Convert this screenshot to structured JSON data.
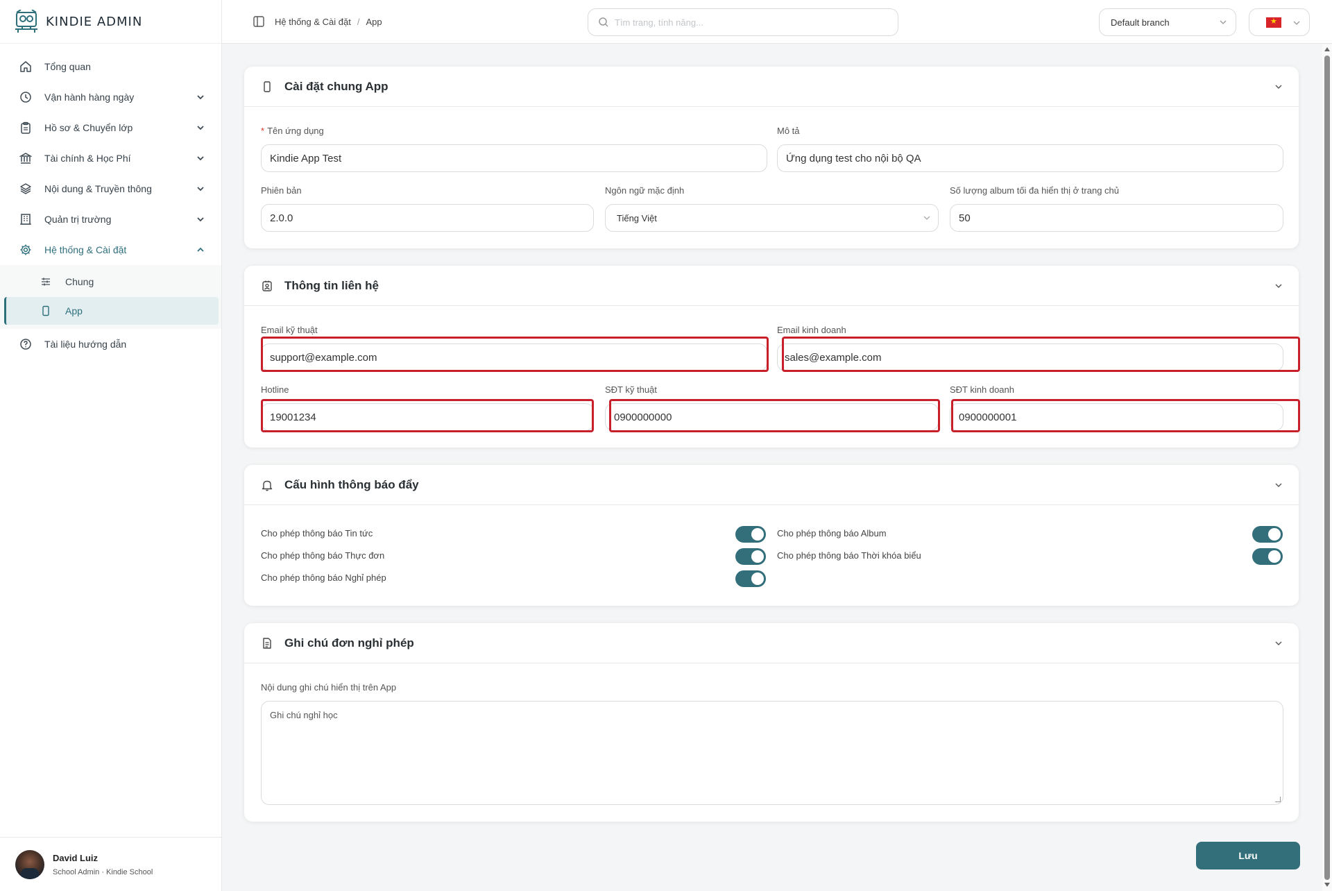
{
  "app": {
    "name": "KINDIE ADMIN"
  },
  "sidebar": {
    "items": [
      {
        "label": "Tổng quan",
        "icon": "home-icon",
        "expandable": false
      },
      {
        "label": "Vận hành hàng ngày",
        "icon": "clock-icon",
        "expandable": true
      },
      {
        "label": "Hồ sơ & Chuyển lớp",
        "icon": "clipboard-icon",
        "expandable": true
      },
      {
        "label": "Tài chính & Học Phí",
        "icon": "bank-icon",
        "expandable": true
      },
      {
        "label": "Nội dung & Truyền thông",
        "icon": "layers-icon",
        "expandable": true
      },
      {
        "label": "Quản trị trường",
        "icon": "building-icon",
        "expandable": true
      },
      {
        "label": "Hệ thống & Cài đặt",
        "icon": "gear-icon",
        "expandable": true,
        "expanded": true
      },
      {
        "label": "Tài liệu hướng dẫn",
        "icon": "help-icon",
        "expandable": false
      }
    ],
    "subitems": [
      {
        "label": "Chung",
        "icon": "sliders-icon"
      },
      {
        "label": "App",
        "icon": "phone-icon",
        "active": true
      }
    ]
  },
  "user": {
    "name": "David Luiz",
    "role": "School Admin · Kindie School"
  },
  "topbar": {
    "breadcrumb": [
      "Hệ thống & Cài đặt",
      "App"
    ],
    "search_placeholder": "Tìm trang, tính năng...",
    "branch": "Default branch",
    "language_flag": "vietnam-flag"
  },
  "sections": {
    "general": {
      "title": "Cài đặt chung App",
      "app_name_label": "Tên ứng dụng",
      "app_name_value": "Kindie App Test",
      "description_label": "Mô tả",
      "description_value": "Ứng dụng test cho nội bộ QA",
      "version_label": "Phiên bản",
      "version_value": "2.0.0",
      "language_label": "Ngôn ngữ mặc định",
      "language_value": "Tiếng Việt",
      "album_label": "Số lượng album tối đa hiển thị ở trang chủ",
      "album_value": "50"
    },
    "contact": {
      "title": "Thông tin liên hệ",
      "tech_email_label": "Email kỹ thuật",
      "tech_email_value": "support@example.com",
      "sales_email_label": "Email kinh doanh",
      "sales_email_value": "sales@example.com",
      "hotline_label": "Hotline",
      "hotline_value": "19001234",
      "tech_phone_label": "SĐT kỹ thuật",
      "tech_phone_value": "0900000000",
      "sales_phone_label": "SĐT kinh doanh",
      "sales_phone_value": "0900000001"
    },
    "push": {
      "title": "Cấu hình thông báo đẩy",
      "toggles": [
        {
          "label": "Cho phép thông báo Tin tức",
          "on": true
        },
        {
          "label": "Cho phép thông báo Album",
          "on": true
        },
        {
          "label": "Cho phép thông báo Thực đơn",
          "on": true
        },
        {
          "label": "Cho phép thông báo Thời khóa biểu",
          "on": true
        },
        {
          "label": "Cho phép thông báo Nghỉ phép",
          "on": true
        }
      ]
    },
    "leave_note": {
      "title": "Ghi chú đơn nghỉ phép",
      "content_label": "Nội dung ghi chú hiển thị trên App",
      "content_value": "Ghi chú nghỉ học"
    }
  },
  "actions": {
    "save_label": "Lưu"
  },
  "colors": {
    "accent": "#326f7b",
    "highlight": "#c8202a"
  }
}
